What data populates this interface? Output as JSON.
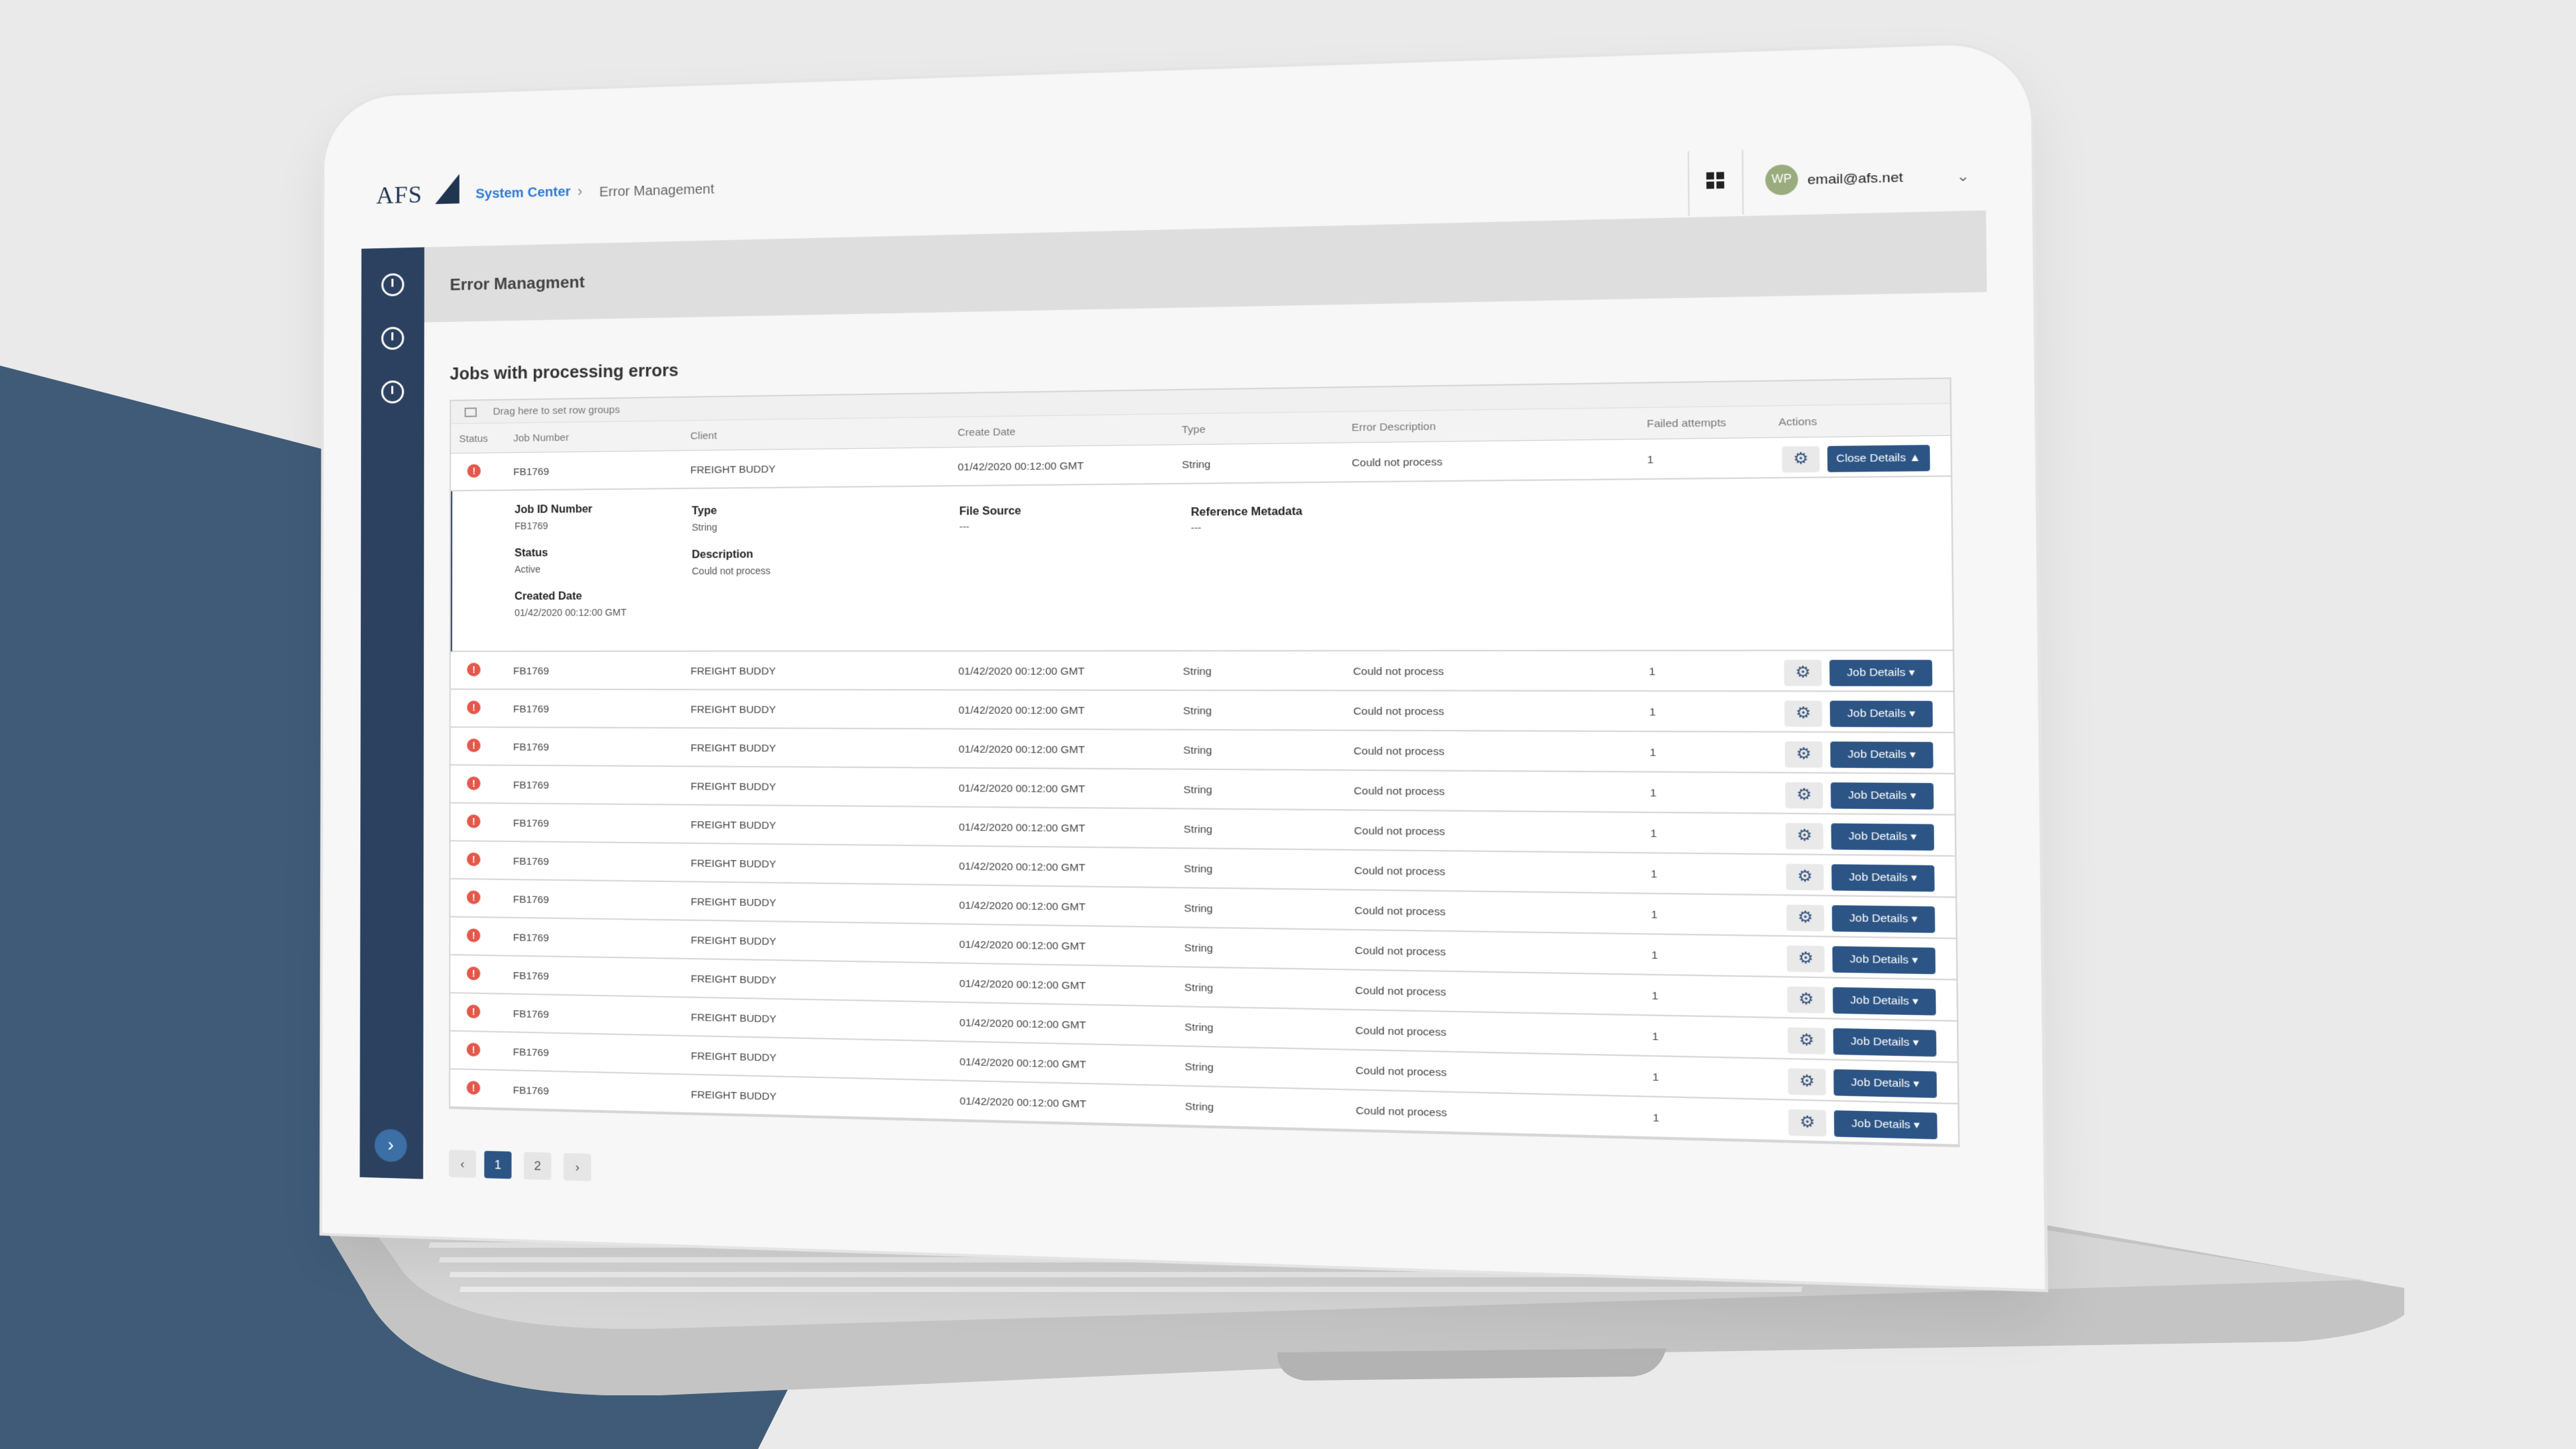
{
  "brand": {
    "logo_text": "AFS"
  },
  "breadcrumb": {
    "link": "System Center",
    "separator": "›",
    "current": "Error Management"
  },
  "user": {
    "initials": "WP",
    "email": "email@afs.net"
  },
  "page": {
    "title": "Error Managment",
    "section_title": "Jobs with processing errors"
  },
  "table": {
    "group_hint": "Drag here to set row groups",
    "columns": [
      "Status",
      "Job Number",
      "Client",
      "Create Date",
      "Type",
      "Error Description",
      "Failed attempts",
      "Actions"
    ],
    "expanded_row": {
      "job_number": "FB1769",
      "client": "FREIGHT BUDDY",
      "create_date": "01/42/2020 00:12:00 GMT",
      "type": "String",
      "error": "Could not process",
      "failed": "1",
      "button": "Close Details ▲"
    },
    "details": {
      "job_id_label": "Job ID Number",
      "job_id_value": "FB1769",
      "status_label": "Status",
      "status_value": "Active",
      "created_label": "Created Date",
      "created_value": "01/42/2020 00:12:00 GMT",
      "type_label": "Type",
      "type_value": "String",
      "description_label": "Description",
      "description_value": "Could not process",
      "file_source_label": "File Source",
      "file_source_value": "---",
      "ref_meta_label": "Reference Metadata",
      "ref_meta_value": "---"
    },
    "rows": [
      {
        "job_number": "FB1769",
        "client": "FREIGHT BUDDY",
        "create_date": "01/42/2020 00:12:00 GMT",
        "type": "String",
        "error": "Could not process",
        "failed": "1",
        "button": "Job Details ▾"
      },
      {
        "job_number": "FB1769",
        "client": "FREIGHT BUDDY",
        "create_date": "01/42/2020 00:12:00 GMT",
        "type": "String",
        "error": "Could not process",
        "failed": "1",
        "button": "Job Details ▾"
      },
      {
        "job_number": "FB1769",
        "client": "FREIGHT BUDDY",
        "create_date": "01/42/2020 00:12:00 GMT",
        "type": "String",
        "error": "Could not process",
        "failed": "1",
        "button": "Job Details ▾"
      },
      {
        "job_number": "FB1769",
        "client": "FREIGHT BUDDY",
        "create_date": "01/42/2020 00:12:00 GMT",
        "type": "String",
        "error": "Could not process",
        "failed": "1",
        "button": "Job Details ▾"
      },
      {
        "job_number": "FB1769",
        "client": "FREIGHT BUDDY",
        "create_date": "01/42/2020 00:12:00 GMT",
        "type": "String",
        "error": "Could not process",
        "failed": "1",
        "button": "Job Details ▾"
      },
      {
        "job_number": "FB1769",
        "client": "FREIGHT BUDDY",
        "create_date": "01/42/2020 00:12:00 GMT",
        "type": "String",
        "error": "Could not process",
        "failed": "1",
        "button": "Job Details ▾"
      },
      {
        "job_number": "FB1769",
        "client": "FREIGHT BUDDY",
        "create_date": "01/42/2020 00:12:00 GMT",
        "type": "String",
        "error": "Could not process",
        "failed": "1",
        "button": "Job Details ▾"
      },
      {
        "job_number": "FB1769",
        "client": "FREIGHT BUDDY",
        "create_date": "01/42/2020 00:12:00 GMT",
        "type": "String",
        "error": "Could not process",
        "failed": "1",
        "button": "Job Details ▾"
      },
      {
        "job_number": "FB1769",
        "client": "FREIGHT BUDDY",
        "create_date": "01/42/2020 00:12:00 GMT",
        "type": "String",
        "error": "Could not process",
        "failed": "1",
        "button": "Job Details ▾"
      },
      {
        "job_number": "FB1769",
        "client": "FREIGHT BUDDY",
        "create_date": "01/42/2020 00:12:00 GMT",
        "type": "String",
        "error": "Could not process",
        "failed": "1",
        "button": "Job Details ▾"
      },
      {
        "job_number": "FB1769",
        "client": "FREIGHT BUDDY",
        "create_date": "01/42/2020 00:12:00 GMT",
        "type": "String",
        "error": "Could not process",
        "failed": "1",
        "button": "Job Details ▾"
      },
      {
        "job_number": "FB1769",
        "client": "FREIGHT BUDDY",
        "create_date": "01/42/2020 00:12:00 GMT",
        "type": "String",
        "error": "Could not process",
        "failed": "1",
        "button": "Job Details ▾"
      }
    ]
  },
  "pagination": {
    "prev": "‹",
    "pages": [
      "1",
      "2"
    ],
    "next": "›",
    "current": "1"
  },
  "icons": {
    "sidebar": [
      "clock-icon",
      "history-icon",
      "timer-icon"
    ],
    "expand": "chevron-right-icon",
    "settings": "gear-icon",
    "apps": "grid-icon",
    "status_error": "error-icon"
  },
  "colors": {
    "sidebar": "#2c415f",
    "accent_button": "#2c5585",
    "link": "#2b7bd6",
    "error": "#e4584b",
    "background_shape": "#3f5b78"
  }
}
